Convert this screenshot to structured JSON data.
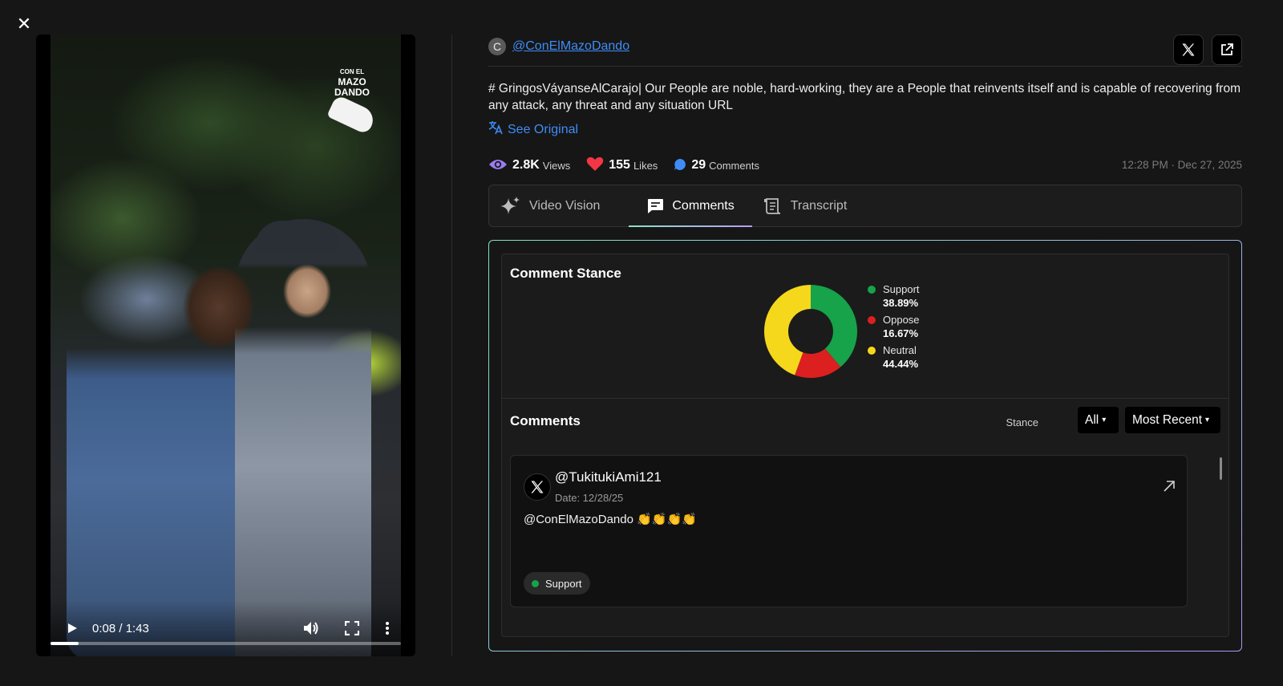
{
  "close_icon": "close-icon",
  "video": {
    "watermark_line1": "CON EL",
    "watermark_line2": "MAZO",
    "watermark_line3": "DANDO",
    "time": "0:08 / 1:43",
    "progress": 0.08
  },
  "post": {
    "avatar_letter": "C",
    "handle": "@ConElMazoDando",
    "text": "# GringosVáyanseAlCarajo| Our People are noble, hard-working, they are a People that reinvents itself and is capable of recovering from any attack, any threat and any situation URL",
    "see_original": "See Original",
    "views_value": "2.8K",
    "views_label": "Views",
    "likes_value": "155",
    "likes_label": "Likes",
    "comments_value": "29",
    "comments_label": "Comments",
    "timestamp": "12:28 PM · Dec 27, 2025"
  },
  "tabs": [
    {
      "label": "Video Vision"
    },
    {
      "label": "Comments"
    },
    {
      "label": "Transcript"
    }
  ],
  "stance": {
    "title": "Comment Stance",
    "colors": {
      "support": "#16a34a",
      "oppose": "#dc1f1f",
      "neutral": "#f5d81c"
    }
  },
  "chart_data": {
    "type": "pie",
    "title": "Comment Stance",
    "categories": [
      "Support",
      "Oppose",
      "Neutral"
    ],
    "values": [
      38.89,
      16.67,
      44.44
    ],
    "labels": [
      "38.89%",
      "16.67%",
      "44.44%"
    ]
  },
  "comments": {
    "title": "Comments",
    "stance_label": "Stance",
    "stance_filter": "All",
    "sort": "Most Recent",
    "items": [
      {
        "user": "@TukitukiAmi121",
        "date": "Date: 12/28/25",
        "text": "@ConElMazoDando 👏👏👏👏",
        "stance": "Support"
      }
    ]
  }
}
